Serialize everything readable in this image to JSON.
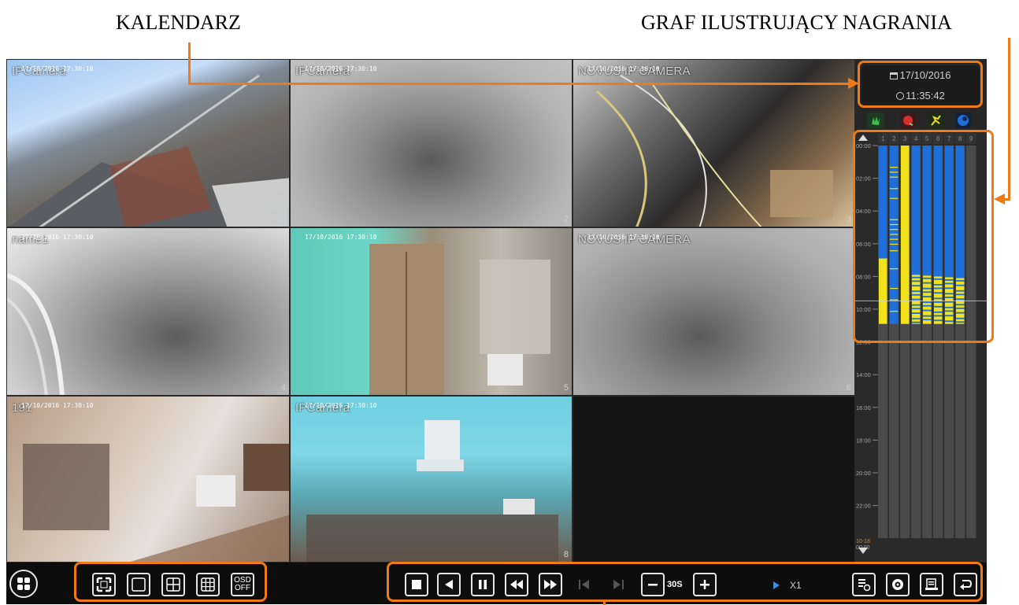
{
  "annotations": {
    "calendar_label": "KALENDARZ",
    "graph_label": "GRAF ILUSTRUJĄCY NAGRANIA"
  },
  "cameras": [
    {
      "title": "IPCamera",
      "stamp": "17/10/2016 17:30:10",
      "num": ""
    },
    {
      "title": "IPCamera",
      "stamp": "17/10/2016 17:30:10",
      "num": "2"
    },
    {
      "title": "NOVUS IP CAMERA",
      "stamp": "17/10/2016 17:30:10",
      "num": "3"
    },
    {
      "title": "name1",
      "stamp": "17/10/2016 17:30:10",
      "num": "4"
    },
    {
      "title": "",
      "stamp": "17/10/2016 17:30:10",
      "num": "5"
    },
    {
      "title": "NOVUS IP CAMERA",
      "stamp": "17/10/2016 17:30:10",
      "num": "6"
    },
    {
      "title": "191",
      "stamp": "17/10/2016 17:30:10",
      "num": ""
    },
    {
      "title": "IPCamera",
      "stamp": "17/10/2016 17:30:10",
      "num": "8"
    },
    {
      "title": "",
      "stamp": "",
      "num": ""
    }
  ],
  "calendar": {
    "date": "17/10/2016",
    "time": "11:35:42",
    "date_icon": "calendar-icon",
    "time_icon": "clock-icon"
  },
  "event_filters": [
    {
      "name": "manual-record-icon",
      "color": "#2e7d32"
    },
    {
      "name": "alarm-record-icon",
      "color": "#c62828"
    },
    {
      "name": "motion-record-icon",
      "color": "#f9a825"
    },
    {
      "name": "schedule-record-icon",
      "color": "#1565c0"
    }
  ],
  "timeline": {
    "hours": [
      "00:00",
      "02:00",
      "04:00",
      "06:00",
      "08:00",
      "10:00",
      "12:00",
      "14:00",
      "16:00",
      "18:00",
      "20:00",
      "22:00"
    ],
    "next_day_label": "10-18",
    "next_day_time": "00:00",
    "channels": [
      "1",
      "2",
      "3",
      "4",
      "5",
      "6",
      "7",
      "8",
      "9"
    ],
    "colors": {
      "continuous": "#1e6fd9",
      "motion": "#f2e21b"
    },
    "recorded_until_hour": 10.9
  },
  "toolbar": {
    "menu_icon": "menu-grid-icon",
    "layout_buttons": [
      "fullscreen-icon",
      "layout-1-icon",
      "layout-4-icon",
      "layout-9-icon"
    ],
    "osd_top": "OSD",
    "osd_bottom": "OFF",
    "step_label": "30S",
    "speed": "X1",
    "accent": "#f07a16"
  }
}
